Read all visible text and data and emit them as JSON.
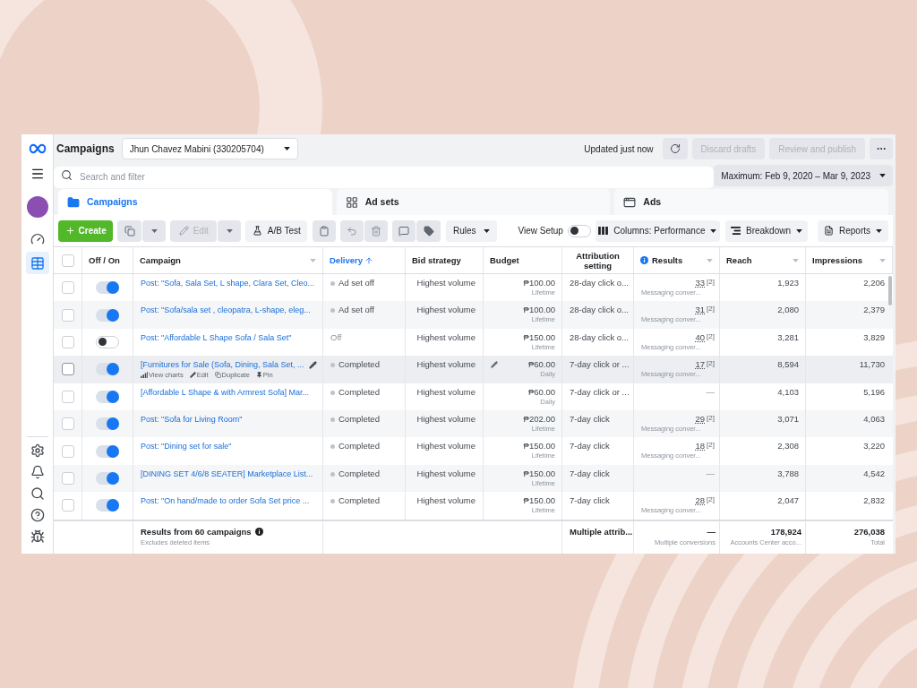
{
  "sidebar": {
    "nav": [
      {
        "selected": false
      },
      {
        "selected": true
      }
    ]
  },
  "header": {
    "title": "Campaigns",
    "account": "Jhun Chavez Mabini (330205704)",
    "status": "Updated just now",
    "buttons": [
      {
        "label": "Discard drafts",
        "disabled": true
      },
      {
        "label": "Review and publish",
        "disabled": true
      }
    ]
  },
  "search": {
    "placeholder": "Search and filter",
    "date_range": "Maximum: Feb 9, 2020 – Mar 9, 2023"
  },
  "tabs": [
    {
      "label": "Campaigns",
      "selected": true
    },
    {
      "label": "Ad sets",
      "selected": false
    },
    {
      "label": "Ads",
      "selected": false
    }
  ],
  "toolbar": {
    "create": "Create",
    "edit": {
      "label": "Edit",
      "disabled": true
    },
    "ab_test": "A/B Test",
    "rules": "Rules",
    "view_setup": {
      "label": "View Setup",
      "on": false
    },
    "columns": "Columns: Performance",
    "breakdown": "Breakdown",
    "reports": "Reports"
  },
  "table": {
    "select_all": {
      "checked": false
    },
    "columns": [
      {
        "label": "Off / On",
        "sorted": false,
        "caret": false,
        "info": false
      },
      {
        "label": "Campaign",
        "sorted": false,
        "caret": true,
        "info": false
      },
      {
        "label": "Delivery",
        "sorted": true,
        "caret": false,
        "info": false
      },
      {
        "label": "Bid strategy",
        "sorted": false,
        "caret": false,
        "info": false
      },
      {
        "label": "Budget",
        "sorted": false,
        "caret": false,
        "info": false
      },
      {
        "label": "Attribution setting",
        "sorted": false,
        "caret": false,
        "info": false
      },
      {
        "label": "Results",
        "sorted": false,
        "caret": true,
        "info": true
      },
      {
        "label": "Reach",
        "sorted": false,
        "caret": true,
        "info": false
      },
      {
        "label": "Impressions",
        "sorted": false,
        "caret": true,
        "info": false
      }
    ],
    "rows": [
      {
        "checked": false,
        "on": true,
        "hovered": false,
        "name": "Post: \"Sofa, Sala Set, L shape, Clara Set, Cleo...",
        "delivery": {
          "text": "Ad set off",
          "dot": true
        },
        "bid_strategy": "Highest volume",
        "budget": {
          "amount": "₱100.00",
          "period": "Lifetime"
        },
        "attribution": "28-day click o...",
        "results": {
          "value": "33",
          "note": "[2]",
          "type": "Messaging conver..."
        },
        "reach": "1,923",
        "impressions": "2,206"
      },
      {
        "checked": false,
        "on": true,
        "hovered": false,
        "name": "Post: \"Sofa/sala set , cleopatra, L-shape, eleg...",
        "delivery": {
          "text": "Ad set off",
          "dot": true
        },
        "bid_strategy": "Highest volume",
        "budget": {
          "amount": "₱100.00",
          "period": "Lifetime"
        },
        "attribution": "28-day click o...",
        "results": {
          "value": "31",
          "note": "[2]",
          "type": "Messaging conver..."
        },
        "reach": "2,080",
        "impressions": "2,379"
      },
      {
        "checked": false,
        "on": false,
        "hovered": false,
        "name": "Post: \"Affordable L Shape Sofa / Sala Set\"",
        "delivery": {
          "text": "Off",
          "dot": false
        },
        "bid_strategy": "Highest volume",
        "budget": {
          "amount": "₱150.00",
          "period": "Lifetime"
        },
        "attribution": "28-day click o...",
        "results": {
          "value": "40",
          "note": "[2]",
          "type": "Messaging conver..."
        },
        "reach": "3,281",
        "impressions": "3,829"
      },
      {
        "checked": false,
        "on": true,
        "hovered": true,
        "name": "[Furnitures for Sale (Sofa, Dining, Sala Set, ...",
        "actions": [
          {
            "label": "View charts"
          },
          {
            "label": "Edit"
          },
          {
            "label": "Duplicate"
          },
          {
            "label": "Pin"
          }
        ],
        "delivery": {
          "text": "Completed",
          "dot": true
        },
        "bid_strategy": "Highest volume",
        "budget": {
          "amount": "₱60.00",
          "period": "Daily"
        },
        "attribution": "7-day click or ...",
        "results": {
          "value": "17",
          "note": "[2]",
          "type": "Messaging conver..."
        },
        "reach": "8,594",
        "impressions": "11,730"
      },
      {
        "checked": false,
        "on": true,
        "hovered": false,
        "name": "[Affordable L Shape & with Armrest Sofa] Mar...",
        "delivery": {
          "text": "Completed",
          "dot": true
        },
        "bid_strategy": "Highest volume",
        "budget": {
          "amount": "₱60.00",
          "period": "Daily"
        },
        "attribution": "7-day click or ...",
        "results": {
          "value": "—"
        },
        "reach": "4,103",
        "impressions": "5,196"
      },
      {
        "checked": false,
        "on": true,
        "hovered": false,
        "name": "Post: \"Sofa for Living Room\"",
        "delivery": {
          "text": "Completed",
          "dot": true
        },
        "bid_strategy": "Highest volume",
        "budget": {
          "amount": "₱202.00",
          "period": "Lifetime"
        },
        "attribution": "7-day click",
        "results": {
          "value": "29",
          "note": "[2]",
          "type": "Messaging conver..."
        },
        "reach": "3,071",
        "impressions": "4,063"
      },
      {
        "checked": false,
        "on": true,
        "hovered": false,
        "name": "Post: \"Dining set for sale\"",
        "delivery": {
          "text": "Completed",
          "dot": true
        },
        "bid_strategy": "Highest volume",
        "budget": {
          "amount": "₱150.00",
          "period": "Lifetime"
        },
        "attribution": "7-day click",
        "results": {
          "value": "18",
          "note": "[2]",
          "type": "Messaging conver..."
        },
        "reach": "2,308",
        "impressions": "3,220"
      },
      {
        "checked": false,
        "on": true,
        "hovered": false,
        "name": "[DINING SET 4/6/8 SEATER] Marketplace List...",
        "delivery": {
          "text": "Completed",
          "dot": true
        },
        "bid_strategy": "Highest volume",
        "budget": {
          "amount": "₱150.00",
          "period": "Lifetime"
        },
        "attribution": "7-day click",
        "results": {
          "value": "—"
        },
        "reach": "3,788",
        "impressions": "4,542"
      },
      {
        "checked": false,
        "on": true,
        "hovered": false,
        "name": "Post: \"On hand/made to order Sofa Set price ...",
        "delivery": {
          "text": "Completed",
          "dot": true
        },
        "bid_strategy": "Highest volume",
        "budget": {
          "amount": "₱150.00",
          "period": "Lifetime"
        },
        "attribution": "7-day click",
        "results": {
          "value": "28",
          "note": "[2]",
          "type": "Messaging conver..."
        },
        "reach": "2,047",
        "impressions": "2,832"
      }
    ],
    "footer": {
      "title": "Results from 60 campaigns",
      "subtitle": "Excludes deleted items",
      "attribution": "Multiple attrib...",
      "results": {
        "value": "—",
        "note": "Multiple conversions"
      },
      "reach": {
        "value": "178,924",
        "note": "Accounts Center acco..."
      },
      "impressions": {
        "value": "276,038",
        "note": "Total"
      }
    }
  }
}
